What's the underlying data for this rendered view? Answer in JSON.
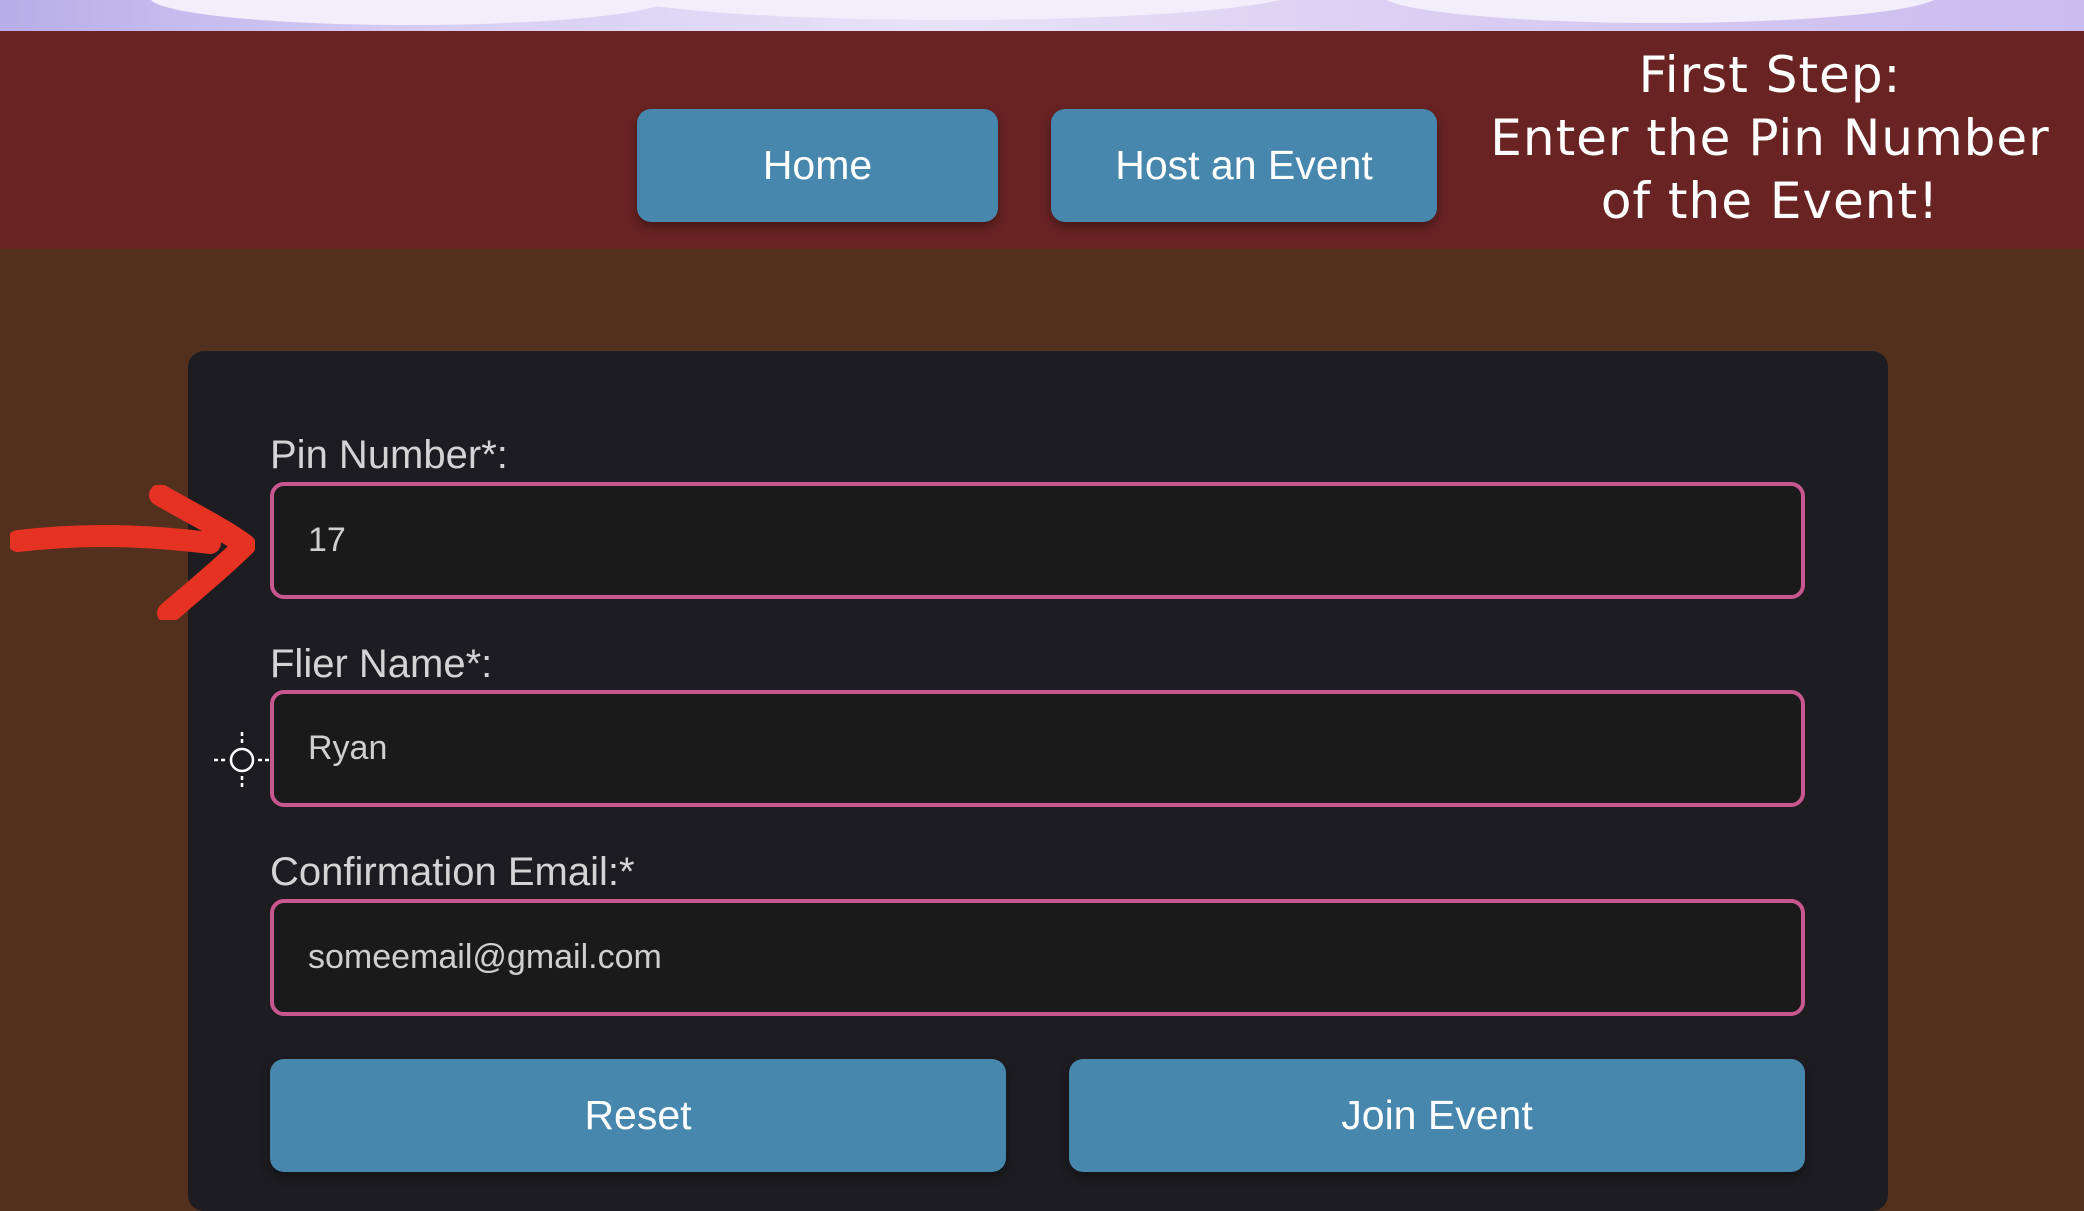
{
  "header": {
    "nav": {
      "home_label": "Home",
      "host_label": "Host an Event"
    },
    "instruction_lines": [
      "First Step:",
      "Enter the Pin Number",
      "of the Event!"
    ]
  },
  "form": {
    "pin": {
      "label": "Pin Number*:",
      "value": "17"
    },
    "flier_name": {
      "label": "Flier Name*:",
      "value": "Ryan"
    },
    "email": {
      "label": "Confirmation Email:*",
      "value": "someemail@gmail.com"
    },
    "reset_label": "Reset",
    "join_label": "Join Event"
  },
  "annotation": {
    "arrow_icon": "red-arrow-icon",
    "cursor_icon": "crosshair-cursor-icon"
  },
  "colors": {
    "header_bg": "#692323",
    "page_bg": "#53301e",
    "panel_bg": "#1d1c20",
    "button_bg": "#4787ae",
    "field_border": "#c8578f",
    "arrow": "#e53223"
  }
}
